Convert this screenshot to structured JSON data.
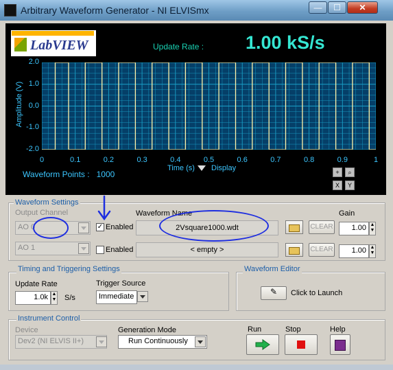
{
  "window": {
    "title": "Arbitrary Waveform Generator - NI ELVISmx",
    "minimize_glyph": "—",
    "maximize_glyph": "☐",
    "close_glyph": "✕"
  },
  "header": {
    "logo_text": "LabVIEW",
    "update_rate_label": "Update Rate :",
    "update_rate_value": "1.00 kS/s"
  },
  "graph": {
    "y_axis_label": "Amplitude (V)",
    "x_axis_label": "Time (s)",
    "display_label": "Display",
    "waveform_points_label": "Waveform Points :",
    "waveform_points_value": "1000",
    "y_ticks": [
      "2.0",
      "1.0",
      "0.0",
      "-1.0",
      "-2.0"
    ],
    "x_ticks": [
      "0",
      "0.1",
      "0.2",
      "0.3",
      "0.4",
      "0.5",
      "0.6",
      "0.7",
      "0.8",
      "0.9",
      "1"
    ],
    "line_color": "#fff2a8",
    "grid_color": "#1aa0c8",
    "background_color": "#053f68",
    "tool_icons": [
      "crosshair-icon",
      "zoom-icon",
      "pan-x-icon",
      "pan-y-icon"
    ]
  },
  "chart_data": {
    "type": "line",
    "xlabel": "Time (s)",
    "ylabel": "Amplitude (V)",
    "xlim": [
      0,
      1
    ],
    "ylim": [
      -2,
      2
    ],
    "grid": true,
    "x": [
      0,
      0.04,
      0.04,
      0.08,
      0.08,
      0.13,
      0.13,
      0.18,
      0.18,
      0.23,
      0.23,
      0.28,
      0.28,
      0.33,
      0.33,
      0.38,
      0.38,
      0.43,
      0.43,
      0.48,
      0.48,
      0.53,
      0.53,
      0.58,
      0.58,
      0.63,
      0.63,
      0.68,
      0.68,
      0.73,
      0.73,
      0.78,
      0.78,
      0.83,
      0.83,
      0.88,
      0.88,
      0.93,
      0.93,
      0.98,
      0.98,
      1
    ],
    "y": [
      -2,
      -2,
      2,
      2,
      -2,
      -2,
      2,
      2,
      -2,
      -2,
      2,
      2,
      -2,
      -2,
      2,
      2,
      -2,
      -2,
      2,
      2,
      -2,
      -2,
      2,
      2,
      -2,
      -2,
      2,
      2,
      -2,
      -2,
      2,
      2,
      -2,
      -2,
      2,
      2,
      -2,
      -2,
      2,
      2,
      -2,
      -2
    ]
  },
  "waveform_settings": {
    "title": "Waveform Settings",
    "output_channel_label": "Output Channel",
    "waveform_name_label": "Waveform Name",
    "gain_label": "Gain",
    "enabled_label": "Enabled",
    "clear_label": "CLEAR",
    "rows": [
      {
        "channel": "AO 0",
        "enabled": true,
        "waveform": "2Vsquare1000.wdt",
        "gain": "1.00"
      },
      {
        "channel": "AO 1",
        "enabled": false,
        "waveform": "< empty >",
        "gain": "1.00"
      }
    ]
  },
  "timing": {
    "title": "Timing and Triggering Settings",
    "update_rate_label": "Update Rate",
    "update_rate_value": "1.0k",
    "update_rate_unit": "S/s",
    "trigger_source_label": "Trigger Source",
    "trigger_source_value": "Immediate"
  },
  "editor": {
    "title": "Waveform Editor",
    "launch_label": "Click to Launch"
  },
  "instrument": {
    "title": "Instrument Control",
    "device_label": "Device",
    "device_value": "Dev2 (NI ELVIS II+)",
    "generation_mode_label": "Generation Mode",
    "generation_mode_value": "Run Continuously",
    "run_label": "Run",
    "stop_label": "Stop",
    "help_label": "Help"
  },
  "annotations": {
    "ink_color": "#1e2ee0"
  }
}
